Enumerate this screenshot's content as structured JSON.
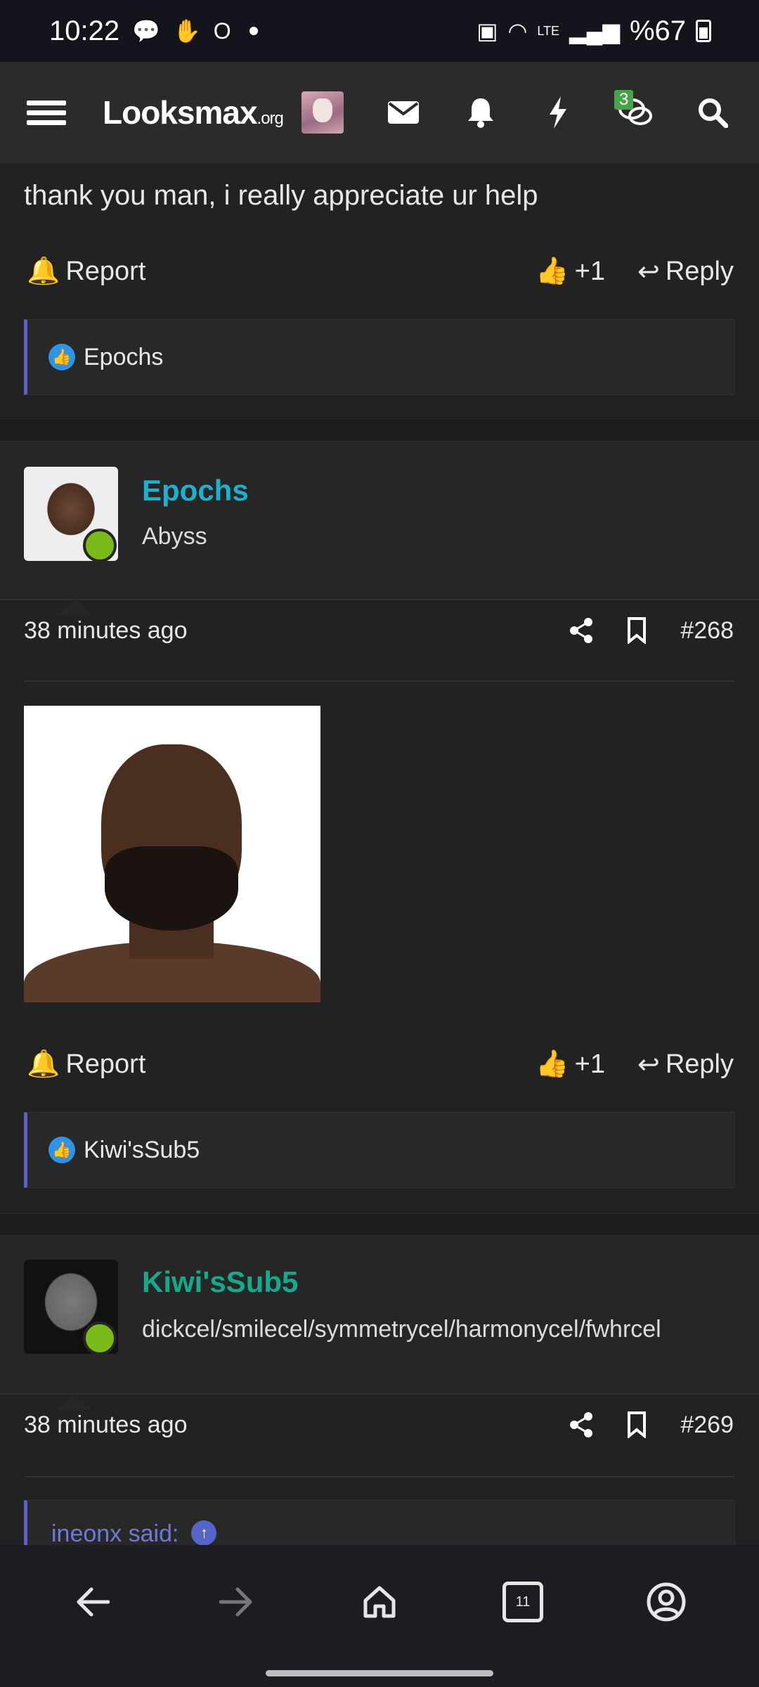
{
  "status_bar": {
    "time": "10:22",
    "battery": "%67",
    "network": "LTE"
  },
  "header": {
    "logo": "Looksmax",
    "logo_suffix": ".org",
    "chat_badge": "3",
    "icons": [
      "menu-icon",
      "envelope-icon",
      "bell-icon",
      "lightning-icon",
      "chat-icon",
      "search-icon"
    ]
  },
  "posts": [
    {
      "body": "thank you man, i really appreciate ur help",
      "report_label": "Report",
      "like_count": "+1",
      "reply_label": "Reply",
      "reactions": "Epochs"
    },
    {
      "username": "Epochs",
      "username_color": "#19b3d1",
      "user_title": "Abyss",
      "time": "38 minutes ago",
      "post_number": "#268",
      "report_label": "Report",
      "like_count": "+1",
      "reply_label": "Reply",
      "reactions": "Kiwi'sSub5"
    },
    {
      "username": "Kiwi'sSub5",
      "username_color": "#17a88e",
      "user_title": "dickcel/smilecel/symmetrycel/harmonycel/fwhrcel",
      "time": "38 minutes ago",
      "post_number": "#269",
      "quote_author": "ineonx said:"
    }
  ],
  "bottom_nav": {
    "tab_count": "11",
    "icons": [
      "back-icon",
      "forward-icon",
      "home-icon",
      "tabs-icon",
      "account-icon"
    ]
  }
}
